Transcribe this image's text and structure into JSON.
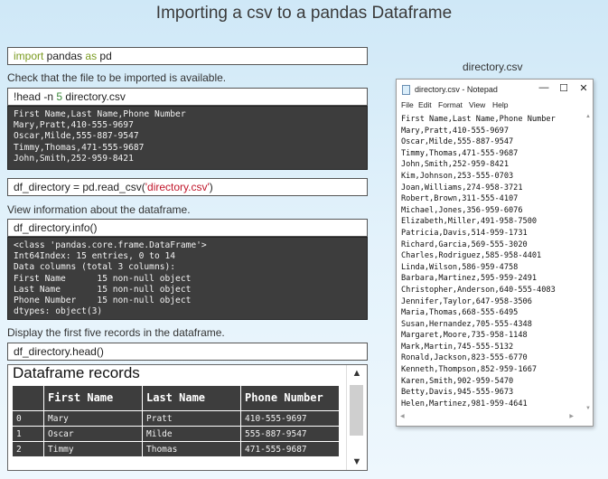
{
  "title": "Importing a csv to a pandas Dataframe",
  "cells": {
    "import": {
      "kw1": "import",
      "mid": " pandas ",
      "kw2": "as",
      "end": " pd"
    },
    "check_label": "Check that the file to be imported is available.",
    "head": {
      "pre": "!head -n ",
      "num": "5",
      "post": " directory.csv"
    },
    "head_output": "First Name,Last Name,Phone Number\nMary,Pratt,410-555-9697\nOscar,Milde,555-887-9547\nTimmy,Thomas,471-555-9687\nJohn,Smith,252-959-8421",
    "read": {
      "pre": "df_directory = pd.read_csv(",
      "str": "'directory.csv'",
      "post": ")"
    },
    "info_label": "View information about the dataframe.",
    "info": "df_directory.info()",
    "info_output": "<class 'pandas.core.frame.DataFrame'>\nInt64Index: 15 entries, 0 to 14\nData columns (total 3 columns):\nFirst Name      15 non-null object\nLast Name       15 non-null object\nPhone Number    15 non-null object\ndtypes: object(3)",
    "first5_label": "Display the first five records in the dataframe.",
    "head_call": "df_directory.head()"
  },
  "dataframe": {
    "title": "Dataframe records",
    "columns": [
      "",
      "First Name",
      "Last Name",
      "Phone Number"
    ],
    "rows": [
      [
        "0",
        "Mary",
        "Pratt",
        "410-555-9697"
      ],
      [
        "1",
        "Oscar",
        "Milde",
        "555-887-9547"
      ],
      [
        "2",
        "Timmy",
        "Thomas",
        "471-555-9687"
      ]
    ]
  },
  "notepad": {
    "caption": "directory.csv",
    "window_title": "directory.csv - Notepad",
    "menu": [
      "File",
      "Edit",
      "Format",
      "View",
      "Help"
    ],
    "controls": {
      "minimize": "—",
      "maximize": "☐",
      "close": "✕"
    },
    "content": "First Name,Last Name,Phone Number\nMary,Pratt,410-555-9697\nOscar,Milde,555-887-9547\nTimmy,Thomas,471-555-9687\nJohn,Smith,252-959-8421\nKim,Johnson,253-555-0703\nJoan,Williams,274-958-3721\nRobert,Brown,311-555-4107\nMichael,Jones,356-959-6076\nElizabeth,Miller,491-958-7500\nPatricia,Davis,514-959-1731\nRichard,Garcia,569-555-3020\nCharles,Rodriguez,585-958-4401\nLinda,Wilson,586-959-4758\nBarbara,Martinez,595-959-2491\nChristopher,Anderson,640-555-4083\nJennifer,Taylor,647-958-3506\nMaria,Thomas,668-555-6495\nSusan,Hernandez,705-555-4348\nMargaret,Moore,735-958-1148\nMark,Martin,745-555-5132\nRonald,Jackson,823-555-6770\nKenneth,Thompson,852-959-1667\nKaren,Smith,902-959-5470\nBetty,Davis,945-555-9673\nHelen,Martinez,981-959-4641"
  }
}
